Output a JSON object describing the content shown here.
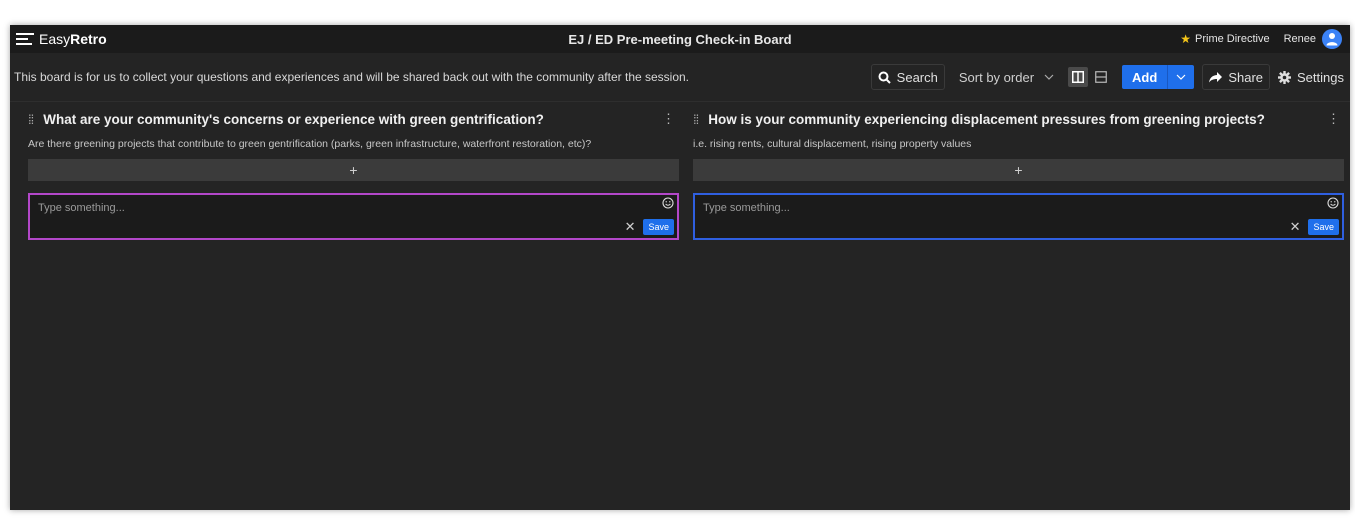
{
  "app": {
    "logo_easy": "Easy",
    "logo_retro": "Retro",
    "board_title": "EJ / ED Pre-meeting Check-in Board",
    "prime_directive": "Prime Directive",
    "user_name": "Renee"
  },
  "toolbar": {
    "board_description": "This board is for us to collect your questions and experiences and will be shared back out with the community after the session.",
    "search_label": "Search",
    "sort_label": "Sort by order",
    "add_label": "Add",
    "share_label": "Share",
    "settings_label": "Settings"
  },
  "columns": [
    {
      "title": "What are your community's concerns or experience with green gentrification?",
      "description": "Are there greening projects that contribute to green gentrification (parks, green infrastructure, waterfront restoration, etc)?",
      "add_symbol": "+",
      "input_placeholder": "Type something...",
      "save_label": "Save",
      "accent_color": "#b347c9"
    },
    {
      "title": "How is your community experiencing displacement pressures from greening projects?",
      "description": "i.e. rising rents, cultural displacement, rising property values",
      "add_symbol": "+",
      "input_placeholder": "Type something...",
      "save_label": "Save",
      "accent_color": "#2f5fe0"
    }
  ],
  "colors": {
    "background": "#242424",
    "topbar": "#1b1b1b",
    "primary": "#1f6feb",
    "star": "#f5c518"
  },
  "icons": [
    "menu-logo-icon",
    "star-icon",
    "user-avatar-icon",
    "search-icon",
    "chevron-down-icon",
    "columns-view-icon",
    "rows-view-icon",
    "share-arrow-icon",
    "gear-icon",
    "drag-handle-icon",
    "kebab-menu-icon",
    "emoji-icon",
    "close-icon"
  ]
}
